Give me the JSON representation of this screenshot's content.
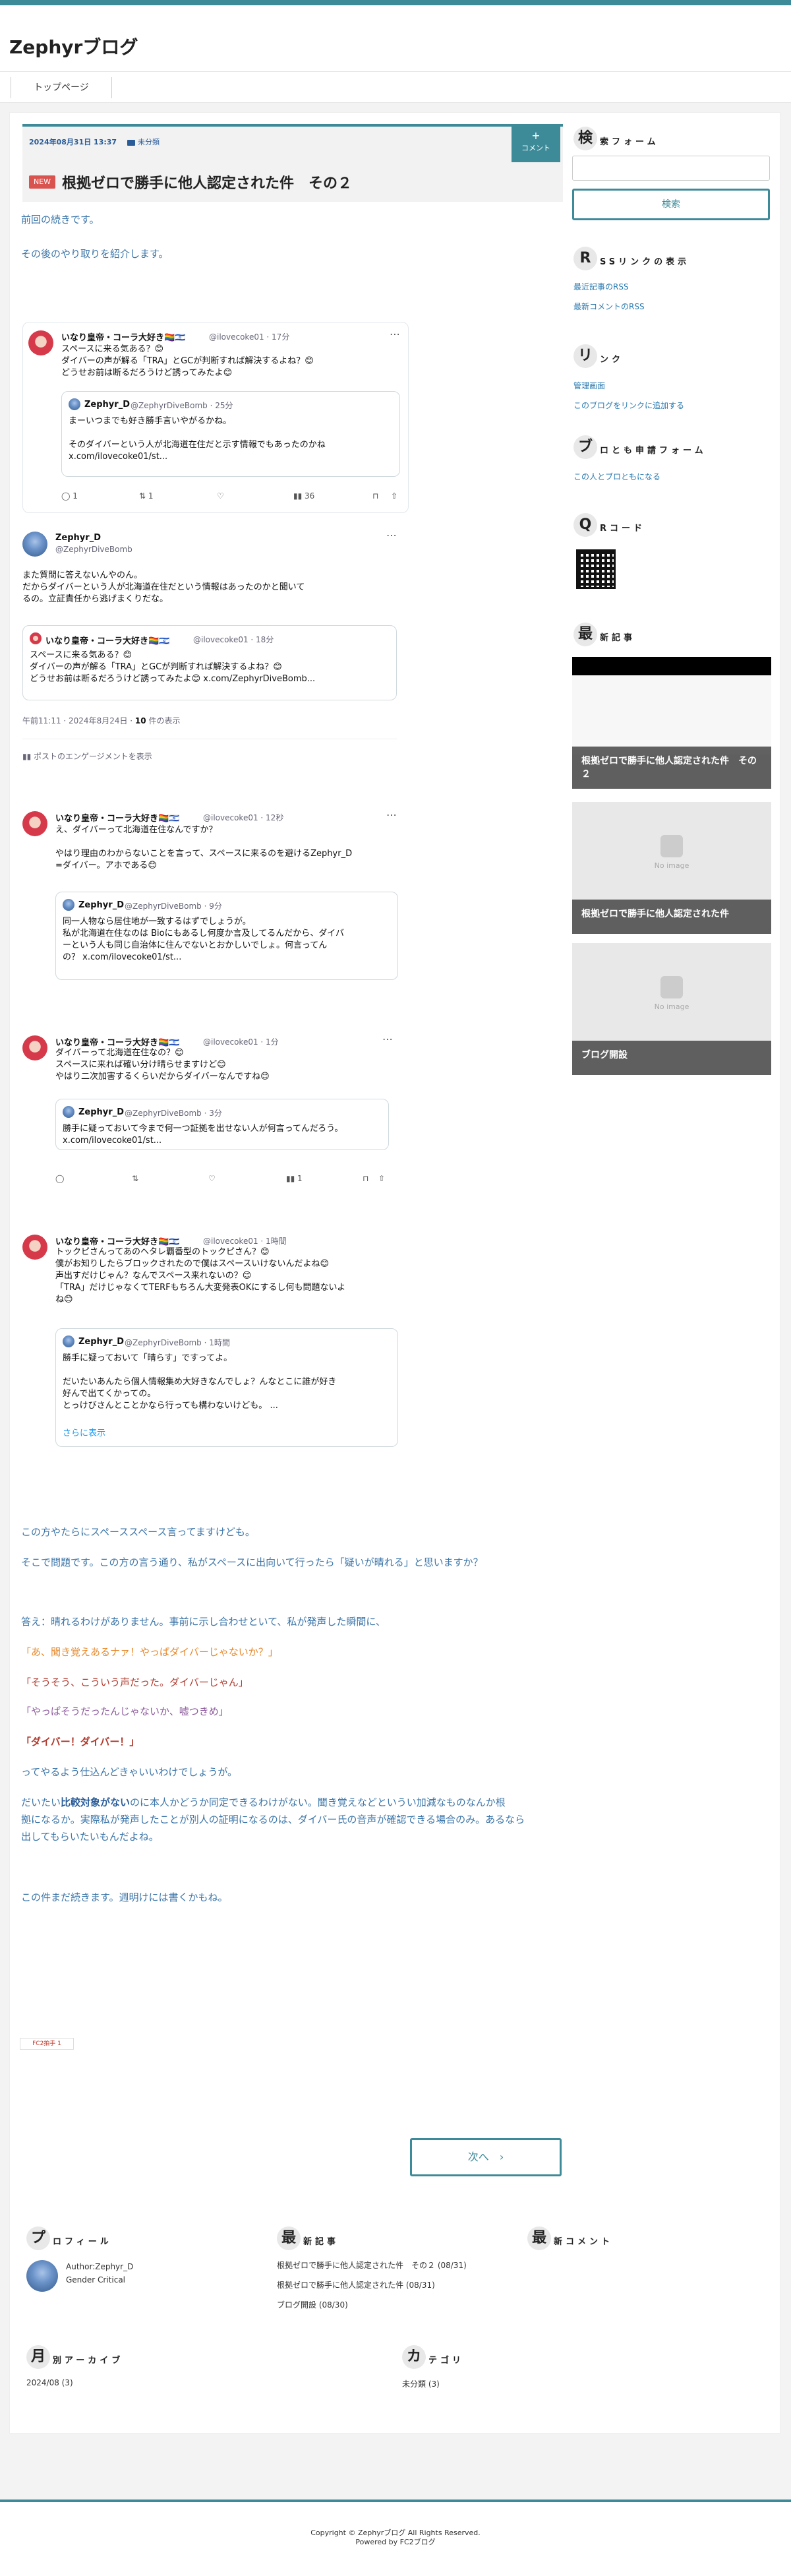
{
  "site": {
    "title": "Zephyrブログ"
  },
  "nav": {
    "home": "トップページ"
  },
  "post": {
    "date": "2024年08月31日 13:37",
    "category": "未分類",
    "comment_label": "コメント",
    "new_badge": "NEW",
    "title": "根拠ゼロで勝手に他人認定された件　その２",
    "intro1": "前回の続きです。",
    "intro2": "その後のやり取りを紹介します。"
  },
  "tweets": {
    "t1": {
      "name": "いなり皇帝・コーラ大好き🏳️‍🌈🇮🇱",
      "handle": "@ilovecoke01 · 17分",
      "body": "スペースに来る気ある？😊\nダイバーの声が解る「TRA」とGCが判断すれば解決するよね？😊\nどうせお前は断るだろうけど誘ってみたよ😊",
      "quote_name": "Zephyr_D",
      "quote_handle": "@ZephyrDiveBomb · 25分",
      "quote_body": "まーいつまでも好き勝手言いやがるかね。\n\nそのダイバーという人が北海道在住だと示す情報でもあったのかね\nx.com/ilovecoke01/st...",
      "replies": "1",
      "retweets": "1",
      "views": "36"
    },
    "t2": {
      "name": "Zephyr_D",
      "handle": "@ZephyrDiveBomb",
      "body": "また質問に答えないんやのん。\nだからダイバーという人が北海道在住だという情報はあったのかと聞いて\nるの。立証責任から逃げまくりだな。",
      "quote_name": "いなり皇帝・コーラ大好き🏳️‍🌈🇮🇱",
      "quote_handle": "@ilovecoke01 · 18分",
      "quote_body": "スペースに来る気ある？😊\nダイバーの声が解る「TRA」とGCが判断すれば解決するよね？😊\nどうせお前は断るだろうけど誘ってみたよ😊 x.com/ZephyrDiveBomb...",
      "time_prefix": "午前11:11 · 2024年8月24日 · ",
      "views_count": "10",
      "views_label": " 件の表示",
      "engagement": "ポストのエンゲージメントを表示"
    },
    "t3": {
      "name": "いなり皇帝・コーラ大好き🏳️‍🌈🇮🇱",
      "handle": "@ilovecoke01 · 12秒",
      "body": "え、ダイバーって北海道在住なんですか？\n\nやはり理由のわからないことを言って、スペースに来るのを避けるZephyr_D\n=ダイバー。アホである😊",
      "quote_name": "Zephyr_D",
      "quote_handle": "@ZephyrDiveBomb · 9分",
      "quote_body": "同一人物なら居住地が一致するはずでしょうが。\n私が北海道在住なのは Bioにもあるし何度か言及してるんだから、ダイバ\nーという人も同じ自治体に住んでないとおかしいでしょ。何言ってん\nの？ x.com/ilovecoke01/st..."
    },
    "t4": {
      "name": "いなり皇帝・コーラ大好き🏳️‍🌈🇮🇱",
      "handle": "@ilovecoke01 · 1分",
      "body": "ダイバーって北海道在住なの？😊\nスペースに来れば確い分け晴らせますけど😊\nやはり二次加害するくらいだからダイバーなんですね😊",
      "quote_name": "Zephyr_D",
      "quote_handle": "@ZephyrDiveBomb · 3分",
      "quote_body": "勝手に疑っておいて今まで何一つ証拠を出せない人が何言ってんだろう。\nx.com/ilovecoke01/st...",
      "views": "1"
    },
    "t5": {
      "name": "いなり皇帝・コーラ大好き🏳️‍🌈🇮🇱",
      "handle": "@ilovecoke01 · 1時間",
      "body": "トックピさんってあのヘタレ覇番型のトックピさん？😊\n僕がお知りしたらブロックされたので僕はスペースいけないんだよね😊\n声出すだけじゃん？なんでスペース来れないの？😊\n「TRA」だけじゃなくてTERFもちろん大変発表OKにするし何も問題ないよ\nね😊",
      "quote_name": "Zephyr_D",
      "quote_handle": "@ZephyrDiveBomb · 1時間",
      "quote_body": "勝手に疑っておいて「晴らす」ですってよ。\n\nだいたいあんたら個人情報集め大好きなんでしょ？んなとこに誰が好き\n好んで出てくかっての。\nとっけびさんとことかなら行っても構わないけども。 ...",
      "more": "さらに表示"
    }
  },
  "body_text": {
    "p1": "この方やたらにスペーススペース言ってますけども。",
    "p2": "そこで問題です。この方の言う通り、私がスペースに出向いて行ったら「疑いが晴れる」と思いますか？",
    "p3": "答え：晴れるわけがありません。事前に示し合わせといて、私が発声した瞬間に、",
    "q1": "「あ、聞き覚えあるナァ！やっぱダイバーじゃないか？」",
    "q2": "「そうそう、こういう声だった。ダイバーじゃん」",
    "q3": "「やっぱそうだったんじゃないか、嘘つきめ」",
    "q4": "「ダイバー！ダイバー！」",
    "p4": "ってやるよう仕込んどきゃいいわけでしょうが。",
    "p5a": "だいたい",
    "p5b": "比較対象がない",
    "p5c": "のに本人かどうか同定できるわけがない。聞き覚えなどというい加減なものなんか根",
    "p5d": "拠になるか。実際私が発声したことが別人の証明になるのは、ダイバー氏の音声が確認できる場合のみ。あるなら",
    "p5e": "出してもらいたいもんだよね。",
    "p6": "この件まだ続きます。週明けには書くかもね。"
  },
  "fc_badge": "FC2拍手 1",
  "next_button": "次へ",
  "sidebar": {
    "search": {
      "cap": "検",
      "rest": "索フォーム",
      "button": "検索"
    },
    "rss": {
      "cap": "R",
      "rest": "SSリンクの表示",
      "links": [
        "最近記事のRSS",
        "最新コメントのRSS"
      ]
    },
    "links": {
      "cap": "リ",
      "rest": "ンク",
      "items": [
        "管理画面",
        "このブログをリンクに追加する"
      ]
    },
    "friends": {
      "cap": "ブ",
      "rest": "ロとも申請フォーム",
      "link": "この人とブロともになる"
    },
    "qr": {
      "cap": "Q",
      "rest": "Rコード"
    },
    "recent": {
      "cap": "最",
      "rest": "新記事",
      "cards": [
        "根拠ゼロで勝手に他人認定された件　その２",
        "根拠ゼロで勝手に他人認定された件",
        "ブログ開設"
      ],
      "no_image": "No image"
    }
  },
  "footer_widgets": {
    "profile": {
      "cap": "プ",
      "rest": "ロフィール",
      "author": "Author:Zephyr_D",
      "desc": "Gender Critical"
    },
    "recent": {
      "cap": "最",
      "rest": "新記事",
      "items": [
        "根拠ゼロで勝手に他人認定された件　その２ (08/31)",
        "根拠ゼロで勝手に他人認定された件 (08/31)",
        "ブログ開設 (08/30)"
      ]
    },
    "comments": {
      "cap": "最",
      "rest": "新コメント"
    },
    "archive": {
      "cap": "月",
      "rest": "別アーカイブ",
      "item": "2024/08 (3)"
    },
    "category": {
      "cap": "カ",
      "rest": "テゴリ",
      "item": "未分類 (3)"
    }
  },
  "footer": {
    "copyright": "Copyright © Zephyrブログ All Rights Reserved.",
    "powered": "Powered by FC2ブログ"
  },
  "colors": {
    "accent": "#3d8a99",
    "link": "#3b75a8",
    "quote_orange": "#e6882a",
    "quote_red": "#b03a2e"
  }
}
